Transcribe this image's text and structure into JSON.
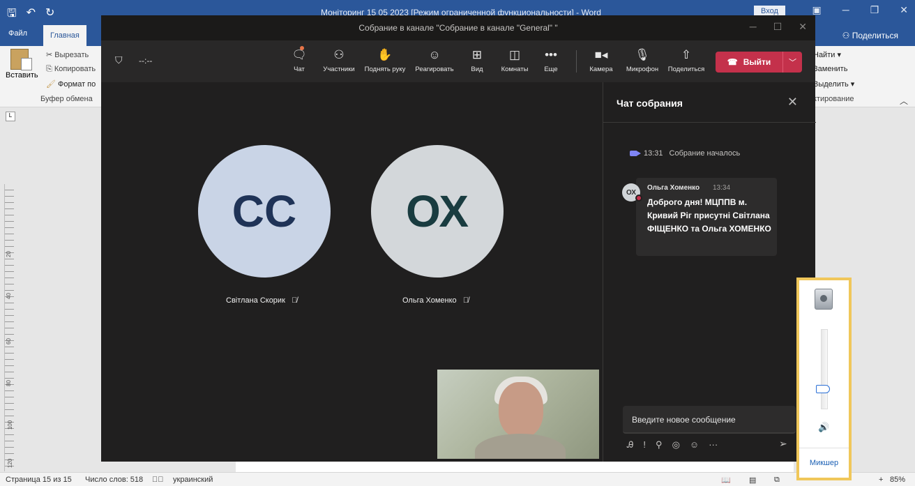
{
  "word": {
    "title": "Моніторинг 15 05 2023 [Режим ограниченной функциональности]  -  Word",
    "login_button": "Вход",
    "tabs": [
      "Файл",
      "Главная"
    ],
    "share": "Поделиться",
    "clipboard": {
      "paste": "Вставить",
      "cut": "Вырезать",
      "copy": "Копировать",
      "format_painter": "Формат по",
      "group_label": "Буфер обмена"
    },
    "editing": {
      "find": "Найти",
      "replace": "Заменить",
      "select": "Выделить",
      "group_label": "ктирование"
    },
    "ruler_marks": [
      "20",
      "40",
      "60",
      "80",
      "100",
      "120"
    ],
    "status": {
      "page": "Страница 15 из 15",
      "words": "Число слов: 518",
      "language": "украинский",
      "zoom": "85%"
    }
  },
  "teams": {
    "window_title": "Собрание в канале \"Собрание в канале \"General\" \"",
    "timer": "--:--",
    "toolbar": {
      "chat": "Чат",
      "participants": "Участники",
      "raise_hand": "Поднять руку",
      "react": "Реагировать",
      "view": "Вид",
      "rooms": "Комнаты",
      "more": "Еще",
      "camera": "Камера",
      "mic": "Микрофон",
      "share": "Поделиться",
      "leave": "Выйти"
    },
    "participants": [
      {
        "initials": "СС",
        "name": "Світлана Скорик",
        "bg": "#c9d4e6",
        "fg": "#1f3357"
      },
      {
        "initials": "ОХ",
        "name": "Ольга Хоменко",
        "bg": "#d3d7da",
        "fg": "#193c40"
      }
    ],
    "chat": {
      "title": "Чат собрания",
      "system_time": "13:31",
      "system_text": "Собрание началось",
      "message": {
        "avatar": "ОХ",
        "author": "Ольга Хоменко",
        "time": "13:34",
        "text": "Доброго дня! МЦППВ м. Кривий Ріг присутні Світлана ФІЩЕНКО та Ольга ХОМЕНКО"
      },
      "compose_placeholder": "Введите новое сообщение"
    }
  },
  "mixer": {
    "label": "Микшер",
    "volume_percent": 25
  },
  "colors": {
    "word_blue": "#2b579a",
    "teams_bg": "#201f1f",
    "leave_red": "#c4314b",
    "accent": "#7f85f5"
  }
}
